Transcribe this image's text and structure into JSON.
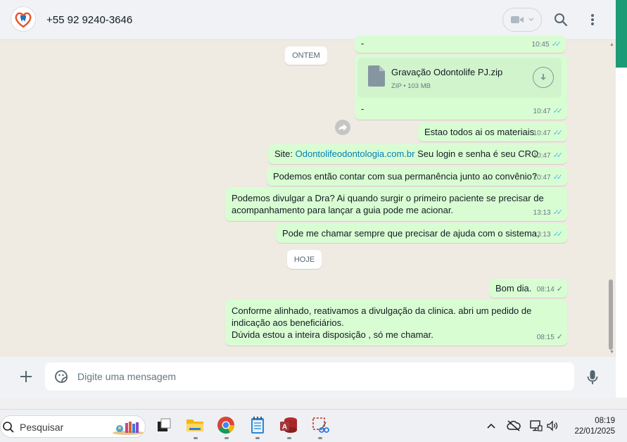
{
  "header": {
    "contact_name": "+55 92 9240-3646",
    "avatar_icon": "tooth-heart-logo",
    "video_icon": "video-camera-icon",
    "search_icon": "search-icon",
    "menu_icon": "kebab-menu-icon"
  },
  "messages": [
    {
      "id": "m0",
      "text": "-",
      "time": "10:45",
      "status": "read"
    },
    {
      "id": "m1",
      "type": "file",
      "file_name": "Gravação Odontolife PJ.zip",
      "file_type": "ZIP",
      "file_size": "103 MB",
      "caption": "-",
      "time": "10:47",
      "status": "read"
    },
    {
      "id": "m2",
      "text": "Estao todos ai os materiais",
      "time": "10:47",
      "status": "read"
    },
    {
      "id": "m3",
      "prefix": "Site: ",
      "link": "Odontolifeodontologia.com.br",
      "suffix": " Seu login e senha é seu CRO",
      "time": "10:47",
      "status": "read"
    },
    {
      "id": "m4",
      "text": "Podemos então contar com sua permanência junto ao convênio?",
      "time": "10:47",
      "status": "read"
    },
    {
      "id": "m5",
      "line1": "Podemos divulgar a Dra? Ai quando surgir o primeiro paciente se precisar de",
      "line2": "acompanhamento para lançar a guia pode me acionar.",
      "time": "13:13",
      "status": "read"
    },
    {
      "id": "m6",
      "text": "Pode me chamar sempre que precisar de ajuda com o sistema,",
      "time": "13:13",
      "status": "read"
    },
    {
      "id": "m7",
      "text": "Bom dia.",
      "time": "08:14",
      "status": "sent"
    },
    {
      "id": "m8",
      "line1": "Conforme alinhado, reativamos a divulgação da clinica. abri um pedido de",
      "line2": "indicação aos beneficiários.",
      "line3": "Dúvida estou a inteira disposição , só me chamar.",
      "time": "08:15",
      "status": "sent"
    }
  ],
  "date_dividers": {
    "yesterday": "ONTEM",
    "today": "HOJE"
  },
  "compose": {
    "placeholder": "Digite uma mensagem"
  },
  "taskbar": {
    "search_label": "Pesquisar",
    "apps": [
      "task-view",
      "file-explorer",
      "chrome",
      "notepad",
      "access",
      "snipping-tool"
    ],
    "time": "08:19",
    "date": "22/01/2025"
  },
  "colors": {
    "outgoing_bubble": "#d9fdd3",
    "read_tick": "#53bdeb",
    "chat_bg": "#efeae2",
    "accent": "#1b9c76"
  }
}
